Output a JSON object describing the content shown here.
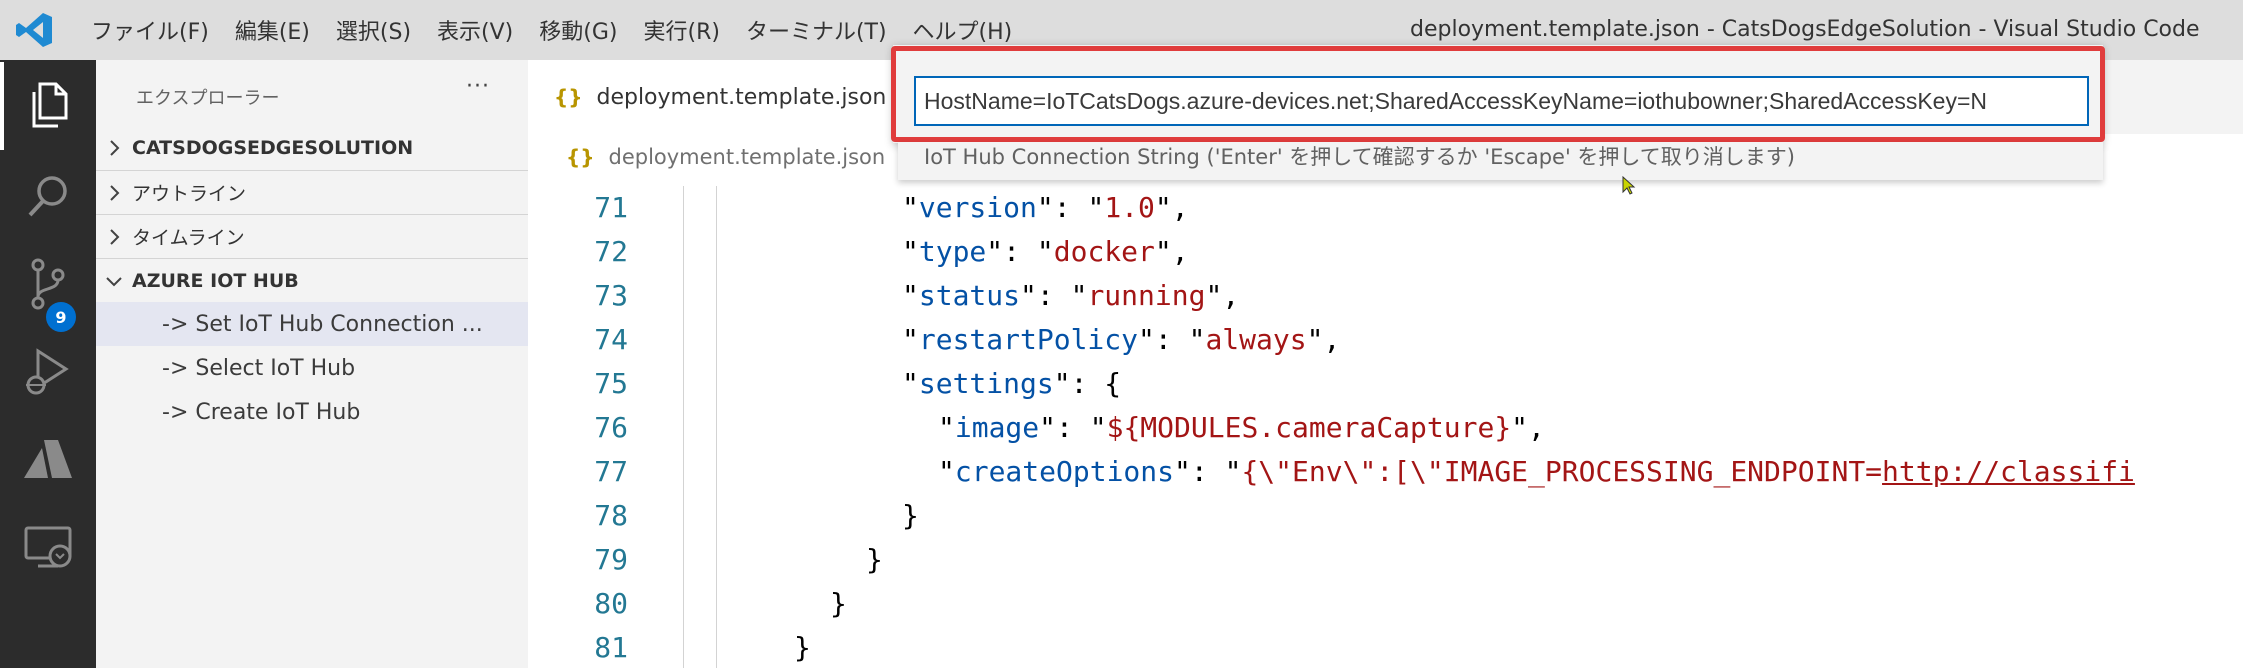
{
  "window": {
    "title": "deployment.template.json - CatsDogsEdgeSolution - Visual Studio Code",
    "menu": [
      "ファイル(F)",
      "編集(E)",
      "選択(S)",
      "表示(V)",
      "移動(G)",
      "実行(R)",
      "ターミナル(T)",
      "ヘルプ(H)"
    ]
  },
  "activity_bar": {
    "items": [
      "explorer-icon",
      "search-icon",
      "source-control-icon",
      "run-debug-icon",
      "azure-icon",
      "remote-explorer-icon"
    ],
    "source_control_badge": "9"
  },
  "sidebar": {
    "title": "エクスプローラー",
    "more_label": "···",
    "sections": {
      "solution": "CATSDOGSEDGESOLUTION",
      "outline": "アウトライン",
      "timeline": "タイムライン",
      "azure_iot_hub": "AZURE IOT HUB"
    },
    "hub_items": [
      "-> Set IoT Hub Connection ...",
      "-> Select IoT Hub",
      "-> Create IoT Hub"
    ]
  },
  "editor": {
    "tab_label": "deployment.template.json",
    "json_icon": "{}",
    "breadcrumb": "deployment.template.json",
    "lines": [
      {
        "num": "71",
        "key": "version",
        "value": "1.0"
      },
      {
        "num": "72",
        "key": "type",
        "value": "docker"
      },
      {
        "num": "73",
        "key": "status",
        "value": "running"
      },
      {
        "num": "74",
        "key": "restartPolicy",
        "value": "always"
      },
      {
        "num": "75",
        "key": "settings"
      },
      {
        "num": "76",
        "key": "image",
        "value": "${MODULES.cameraCapture}"
      },
      {
        "num": "77",
        "key": "createOptions",
        "value_start": "{\\\"Env\\\":[\\\"IMAGE_PROCESSING_ENDPOINT=",
        "url": "http://classifi"
      },
      {
        "num": "78",
        "text": "}"
      },
      {
        "num": "79",
        "text": "}"
      },
      {
        "num": "80",
        "text": "}"
      },
      {
        "num": "81",
        "text": "}"
      }
    ]
  },
  "quick_input": {
    "value": "HostName=IoTCatsDogs.azure-devices.net;SharedAccessKeyName=iothubowner;SharedAccessKey=N",
    "message": "IoT Hub Connection String ('Enter' を押して確認するか 'Escape' を押して取り消します)"
  },
  "colors": {
    "titlebar": "#dddddd",
    "activity_bar": "#2c2c2c",
    "sidebar": "#f3f3f3",
    "highlight_border": "#e03c3c",
    "json_key": "#0451a5",
    "json_string": "#a31515",
    "line_number": "#237893"
  }
}
